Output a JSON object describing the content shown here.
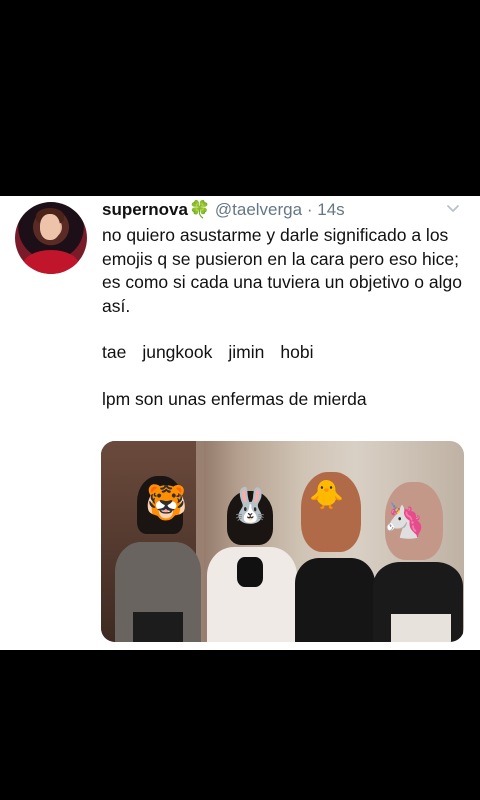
{
  "tweet": {
    "display_name": "supernova",
    "name_emoji": "🍀",
    "handle": "@taelverga",
    "separator": "·",
    "time": "14s",
    "paragraphs": [
      "no quiero asustarme y darle significado a los emojis q se pusieron en la cara pero eso hice; es como si cada una tuviera un objetivo o algo así."
    ],
    "names": [
      "tae",
      "jungkook",
      "jimin",
      "hobi"
    ],
    "closing": "lpm son unas enfermas de mierda",
    "photo_masks": [
      "🐯",
      "🐰",
      "🐥",
      "🦄"
    ]
  },
  "icons": {
    "menu": "chevron-down-icon",
    "avatar": "user-avatar"
  },
  "colors": {
    "background": "#000000",
    "card": "#ffffff",
    "secondary_text": "#657786",
    "primary_text": "#111111",
    "clover": "#2e9b2e"
  }
}
